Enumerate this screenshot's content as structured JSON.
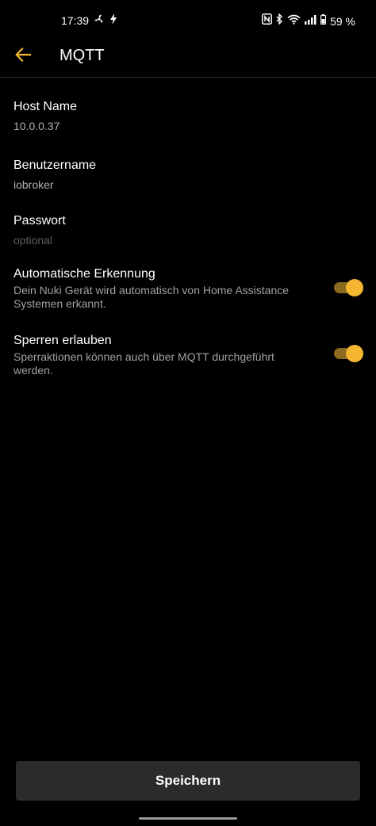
{
  "status_bar": {
    "time": "17:39",
    "battery": "59 %",
    "icons": [
      "fan-icon",
      "flash-icon",
      "nfc-icon",
      "bluetooth-icon",
      "wifi-icon",
      "signal-icon",
      "battery-icon"
    ]
  },
  "app_bar": {
    "title": "MQTT",
    "back_icon": "arrow-left-icon"
  },
  "fields": [
    {
      "label": "Host Name",
      "value": "10.0.0.37",
      "placeholder": ""
    },
    {
      "label": "Benutzername",
      "value": "iobroker",
      "placeholder": ""
    },
    {
      "label": "Passwort",
      "value": "",
      "placeholder": "optional"
    }
  ],
  "toggles": [
    {
      "title": "Automatische Erkennung",
      "description": "Dein Nuki Gerät wird automatisch von Home Assistance Systemen erkannt.",
      "enabled": true
    },
    {
      "title": "Sperren erlauben",
      "description": "Sperraktionen können auch über MQTT durchgeführt werden.",
      "enabled": true
    }
  ],
  "save_button": {
    "label": "Speichern"
  },
  "colors": {
    "accent": "#f5b731",
    "background": "#000000",
    "button_bg": "#2b2b2b"
  }
}
